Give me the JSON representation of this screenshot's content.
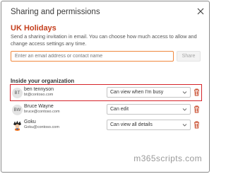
{
  "dialog": {
    "title": "Sharing and permissions",
    "item_name": "UK Holidays",
    "description": "Send a sharing invitation in email. You can choose how much access to allow and change access settings any time."
  },
  "invite": {
    "placeholder": "Enter an email address or contact name",
    "value": "",
    "share_label": "Share"
  },
  "section": {
    "heading": "Inside your organization"
  },
  "people": [
    {
      "initials": "BT",
      "name": "ben tennyson",
      "email": "bt@contoso.com",
      "permission": "Can view when I'm busy",
      "avatar": "initials"
    },
    {
      "initials": "BW",
      "name": "Bruce Wayne",
      "email": "bruce@contoso.com",
      "permission": "Can edit",
      "avatar": "initials"
    },
    {
      "initials": "",
      "name": "Goku",
      "email": "Goku@contoso.com",
      "permission": "Can view all details",
      "avatar": "photo"
    }
  ],
  "colors": {
    "accent": "#c43e1c",
    "highlight": "#d6242a",
    "trash": "#c43e1c",
    "input_border": "#f0883e"
  },
  "watermark": {
    "text": "m365scripts.com"
  }
}
